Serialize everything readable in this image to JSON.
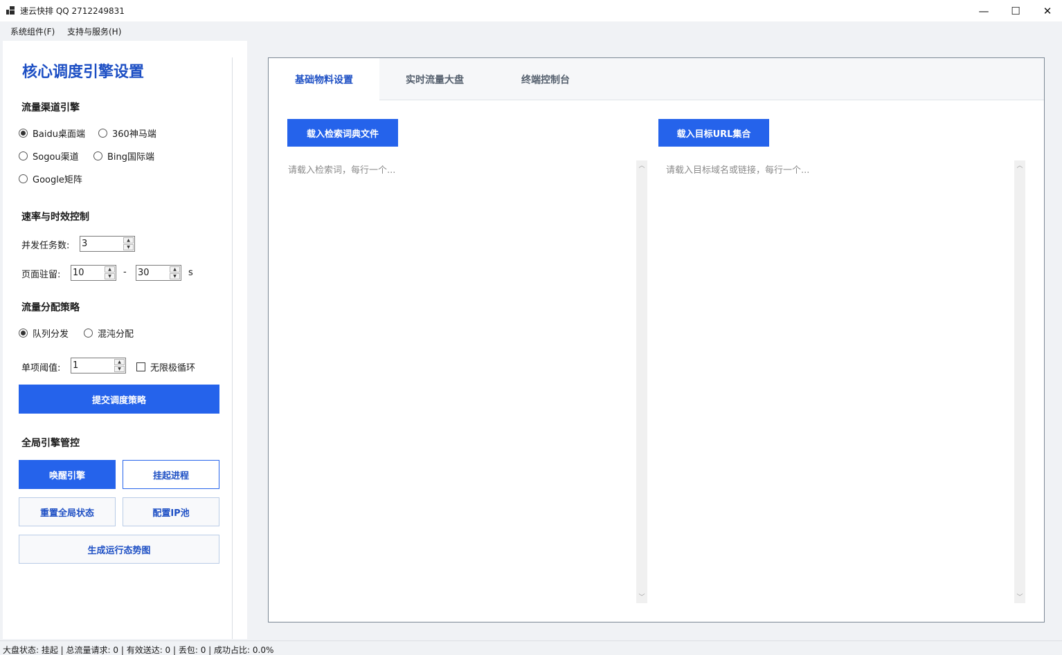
{
  "window": {
    "title": "速云快排 QQ 2712249831",
    "minimize": "—",
    "maximize": "☐",
    "close": "✕"
  },
  "menu": [
    "系统组件(F)",
    "支持与服务(H)"
  ],
  "left": {
    "title": "核心调度引擎设置",
    "channel": {
      "title": "流量渠道引擎",
      "options": [
        "Baidu桌面端",
        "360神马端",
        "Sogou渠道",
        "Bing国际端",
        "Google矩阵"
      ],
      "selected": "Baidu桌面端"
    },
    "rate": {
      "title": "速率与时效控制",
      "concurrency_label": "并发任务数:",
      "concurrency_value": "3",
      "dwell_label": "页面驻留:",
      "dwell_min": "10",
      "dwell_sep": "-",
      "dwell_max": "30",
      "dwell_unit": "s"
    },
    "strategy": {
      "title": "流量分配策略",
      "options": [
        "队列分发",
        "混沌分配"
      ],
      "selected": "队列分发",
      "threshold_label": "单项阈值:",
      "threshold_value": "1",
      "loop_label": "无限极循环",
      "submit": "提交调度策略"
    },
    "global": {
      "title": "全局引擎管控",
      "wake": "唤醒引擎",
      "suspend": "挂起进程",
      "reset": "重置全局状态",
      "ip_pool": "配置IP池",
      "chart": "生成运行态势图"
    }
  },
  "tabs": [
    "基础物料设置",
    "实时流量大盘",
    "终端控制台"
  ],
  "active_tab": "基础物料设置",
  "keywords": {
    "load_button": "载入检索词典文件",
    "placeholder": "请载入检索词，每行一个..."
  },
  "urls": {
    "load_button": "载入目标URL集合",
    "placeholder": "请载入目标域名或链接，每行一个..."
  },
  "status": "大盘状态: 挂起 | 总流量请求: 0 | 有效送达: 0 | 丢包: 0 | 成功占比: 0.0%"
}
